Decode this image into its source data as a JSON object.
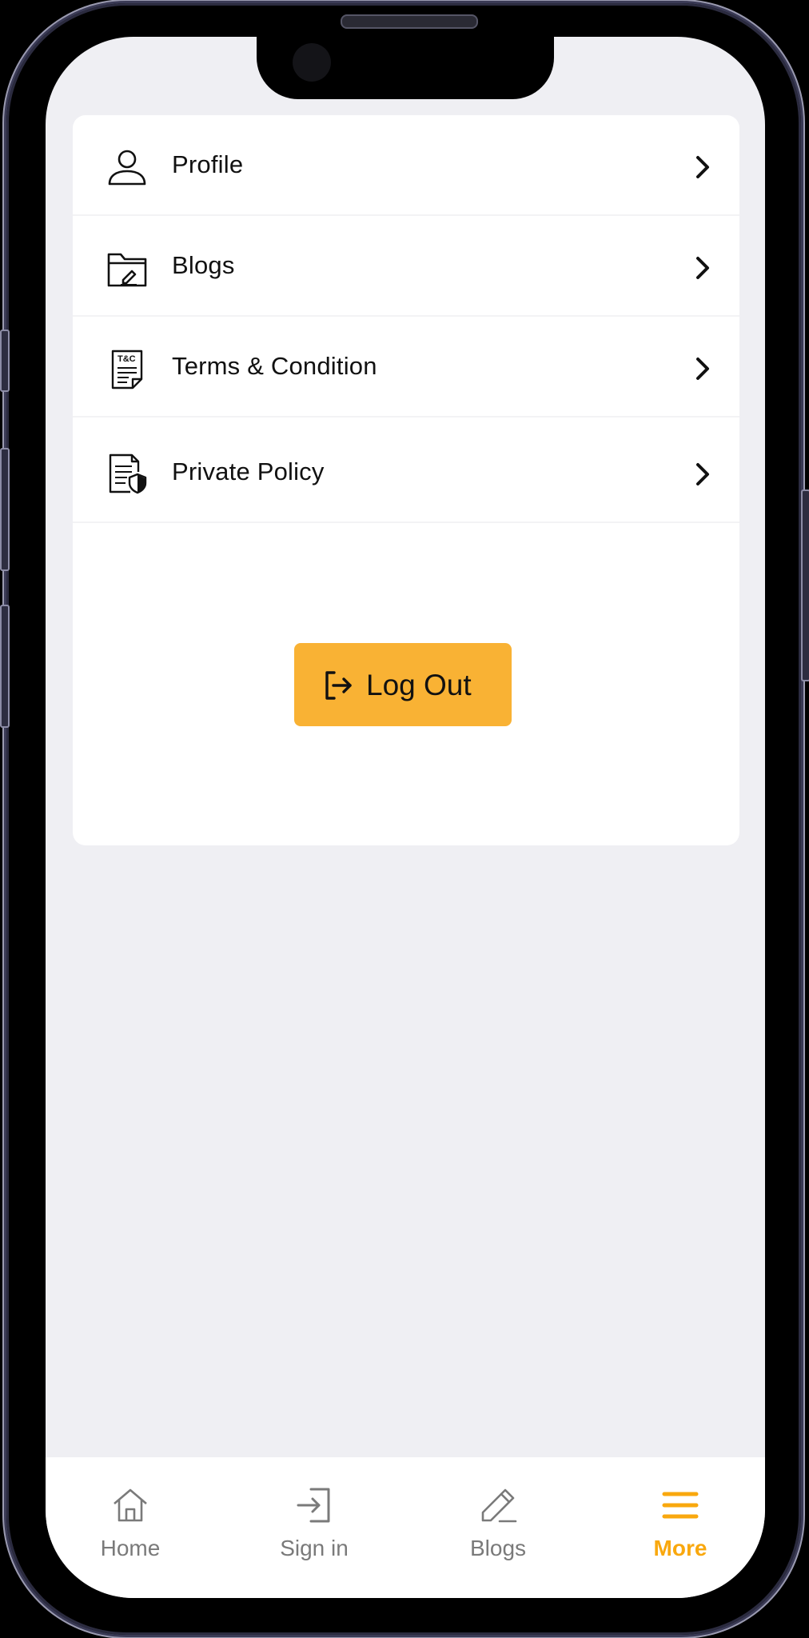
{
  "menu": {
    "items": [
      {
        "label": "Profile",
        "icon": "user-icon"
      },
      {
        "label": "Blogs",
        "icon": "folder-edit-icon"
      },
      {
        "label": "Terms & Condition",
        "icon": "terms-document-icon",
        "icon_text": "T&C"
      },
      {
        "label": "Private Policy",
        "icon": "document-shield-icon"
      }
    ]
  },
  "logout": {
    "label": "Log Out",
    "icon": "logout-icon"
  },
  "tabbar": {
    "tabs": [
      {
        "label": "Home",
        "icon": "home-icon",
        "active": false
      },
      {
        "label": "Sign in",
        "icon": "sign-in-icon",
        "active": false
      },
      {
        "label": "Blogs",
        "icon": "pen-icon",
        "active": false
      },
      {
        "label": "More",
        "icon": "menu-icon",
        "active": true
      }
    ]
  },
  "colors": {
    "accent": "#f9b234",
    "active_tab": "#f9a80e",
    "screen_bg": "#efeff3",
    "card_bg": "#ffffff",
    "inactive_tab": "#7a7a7a"
  }
}
